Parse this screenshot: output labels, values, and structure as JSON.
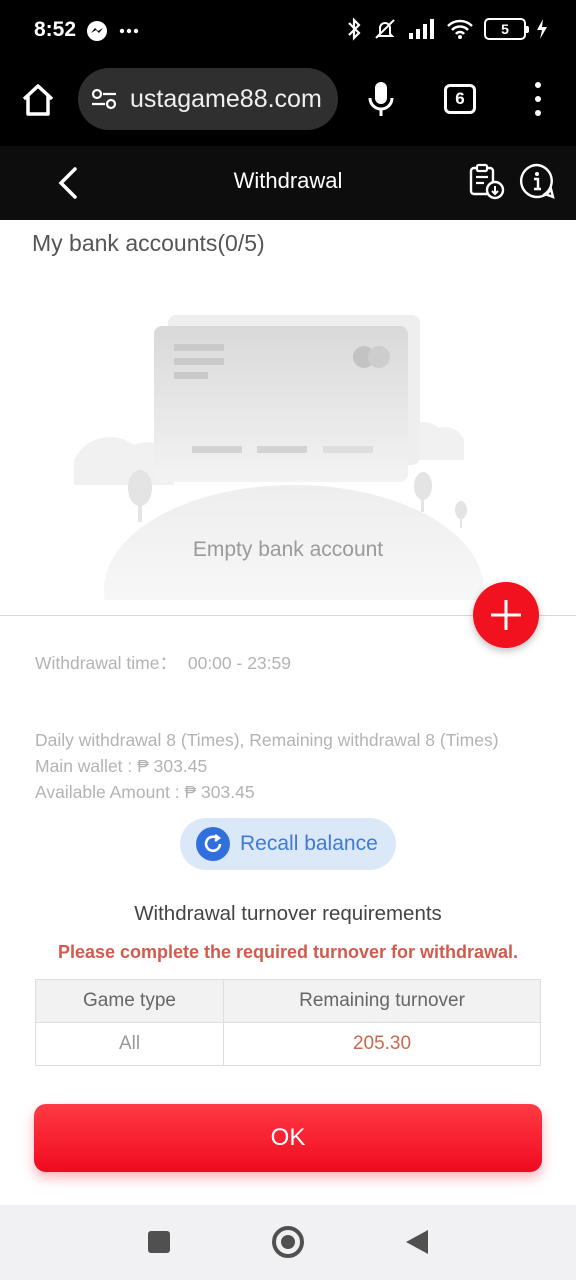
{
  "status_bar": {
    "time": "8:52",
    "battery": "5",
    "icons": [
      "messenger-icon",
      "more-dots-icon",
      "bluetooth-icon",
      "mute-icon",
      "signal-icon",
      "wifi-icon",
      "battery-icon",
      "charging-icon"
    ]
  },
  "browser": {
    "url": "ustagame88.com",
    "tab_count": "6",
    "icons": [
      "home-icon",
      "site-settings-icon",
      "mic-icon",
      "tabs-icon",
      "menu-icon"
    ]
  },
  "header": {
    "title": "Withdrawal",
    "icons": [
      "back-icon",
      "withdraw-record-icon",
      "help-icon"
    ]
  },
  "bank_accounts": {
    "title": "My bank accounts(0/5)",
    "empty_text": "Empty bank account"
  },
  "info": {
    "withdrawal_time_label": "Withdrawal time：",
    "withdrawal_time_value": "00:00 - 23:59",
    "daily_limit": "Daily withdrawal 8 (Times), Remaining withdrawal 8 (Times)",
    "main_wallet": "Main wallet : ₱ 303.45",
    "available_amount": "Available Amount : ₱ 303.45"
  },
  "recall": {
    "label": "Recall balance"
  },
  "turnover": {
    "title": "Withdrawal turnover requirements",
    "warning": "Please complete the required turnover for withdrawal.",
    "columns": [
      "Game type",
      "Remaining turnover"
    ],
    "rows": [
      {
        "game_type": "All",
        "remaining": "205.30"
      }
    ]
  },
  "ok_button": {
    "label": "OK"
  },
  "colors": {
    "accent_red": "#f2111e",
    "recall_blue": "#3f7ad7",
    "warning_text": "#d35a4e",
    "amount_text": "#c96a4e"
  }
}
